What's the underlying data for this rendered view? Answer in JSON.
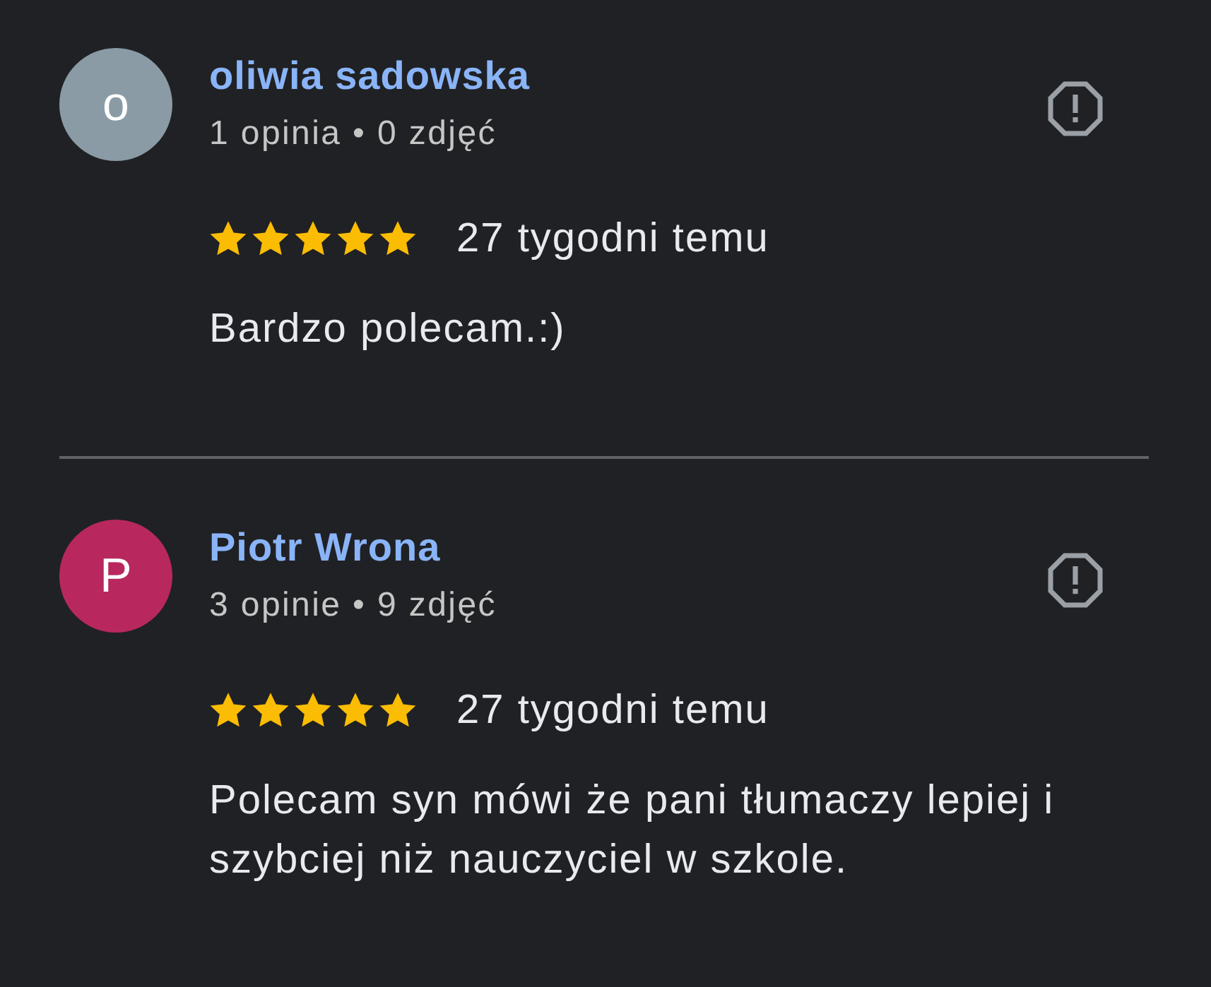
{
  "reviews": [
    {
      "author": "oliwia sadowska",
      "avatar": {
        "letter": "o",
        "color": "#8a9ba6"
      },
      "meta": "1 opinia • 0 zdjęć",
      "stars": 5,
      "time": "27 tygodni temu",
      "text": "Bardzo polecam.:)"
    },
    {
      "author": "Piotr Wrona",
      "avatar": {
        "letter": "P",
        "color": "#b8285f"
      },
      "meta": "3 opinie • 9 zdjęć",
      "stars": 5,
      "time": "27 tygodni temu",
      "text": "Polecam syn mówi że pani tłumaczy lepiej i szybciej niż nauczyciel w szkole."
    }
  ]
}
